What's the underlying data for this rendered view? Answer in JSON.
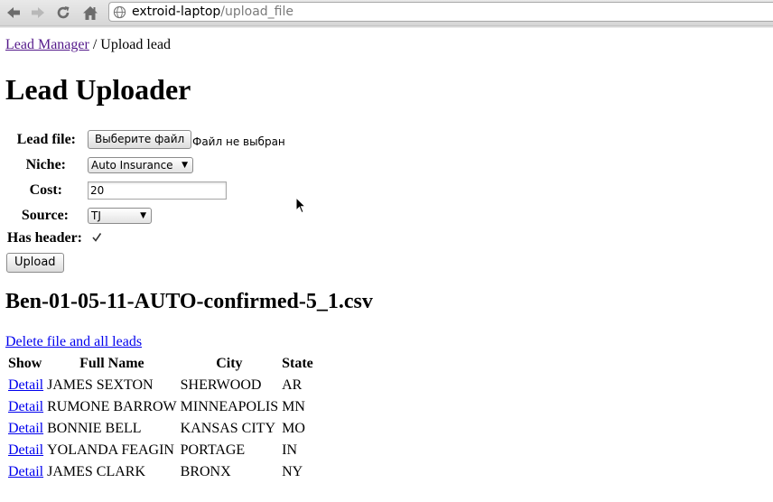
{
  "browser": {
    "url_host": "extroid-laptop",
    "url_path": "/upload_file"
  },
  "breadcrumb": {
    "parent_link": "Lead Manager",
    "separator": " / ",
    "current": "Upload lead"
  },
  "title": "Lead Uploader",
  "form": {
    "lead_file_label": "Lead file:",
    "file_button": "Выберите файл",
    "file_status": "Файл не выбран",
    "niche_label": "Niche:",
    "niche_value": "Auto Insurance",
    "cost_label": "Cost:",
    "cost_value": "20",
    "source_label": "Source:",
    "source_value": "TJ",
    "has_header_label": "Has header:",
    "has_header_checked": true,
    "upload_button": "Upload"
  },
  "file": {
    "name": "Ben-01-05-11-AUTO-confirmed-5_1.csv",
    "delete_link": "Delete file and all leads"
  },
  "table": {
    "headers": [
      "Show",
      "Full Name",
      "City",
      "State"
    ],
    "rows": [
      {
        "link": "Detail",
        "name": "JAMES SEXTON",
        "city": "SHERWOOD",
        "state": "AR"
      },
      {
        "link": "Detail",
        "name": "RUMONE BARROW",
        "city": "MINNEAPOLIS",
        "state": "MN"
      },
      {
        "link": "Detail",
        "name": "BONNIE BELL",
        "city": "KANSAS CITY",
        "state": "MO"
      },
      {
        "link": "Detail",
        "name": "YOLANDA FEAGIN",
        "city": "PORTAGE",
        "state": "IN"
      },
      {
        "link": "Detail",
        "name": "JAMES CLARK",
        "city": "BRONX",
        "state": "NY"
      }
    ]
  },
  "icons": {
    "back": "back-arrow-icon",
    "forward": "forward-arrow-icon",
    "reload": "reload-icon",
    "home": "home-icon",
    "page": "globe-icon",
    "pointer": "mouse-pointer-icon"
  }
}
